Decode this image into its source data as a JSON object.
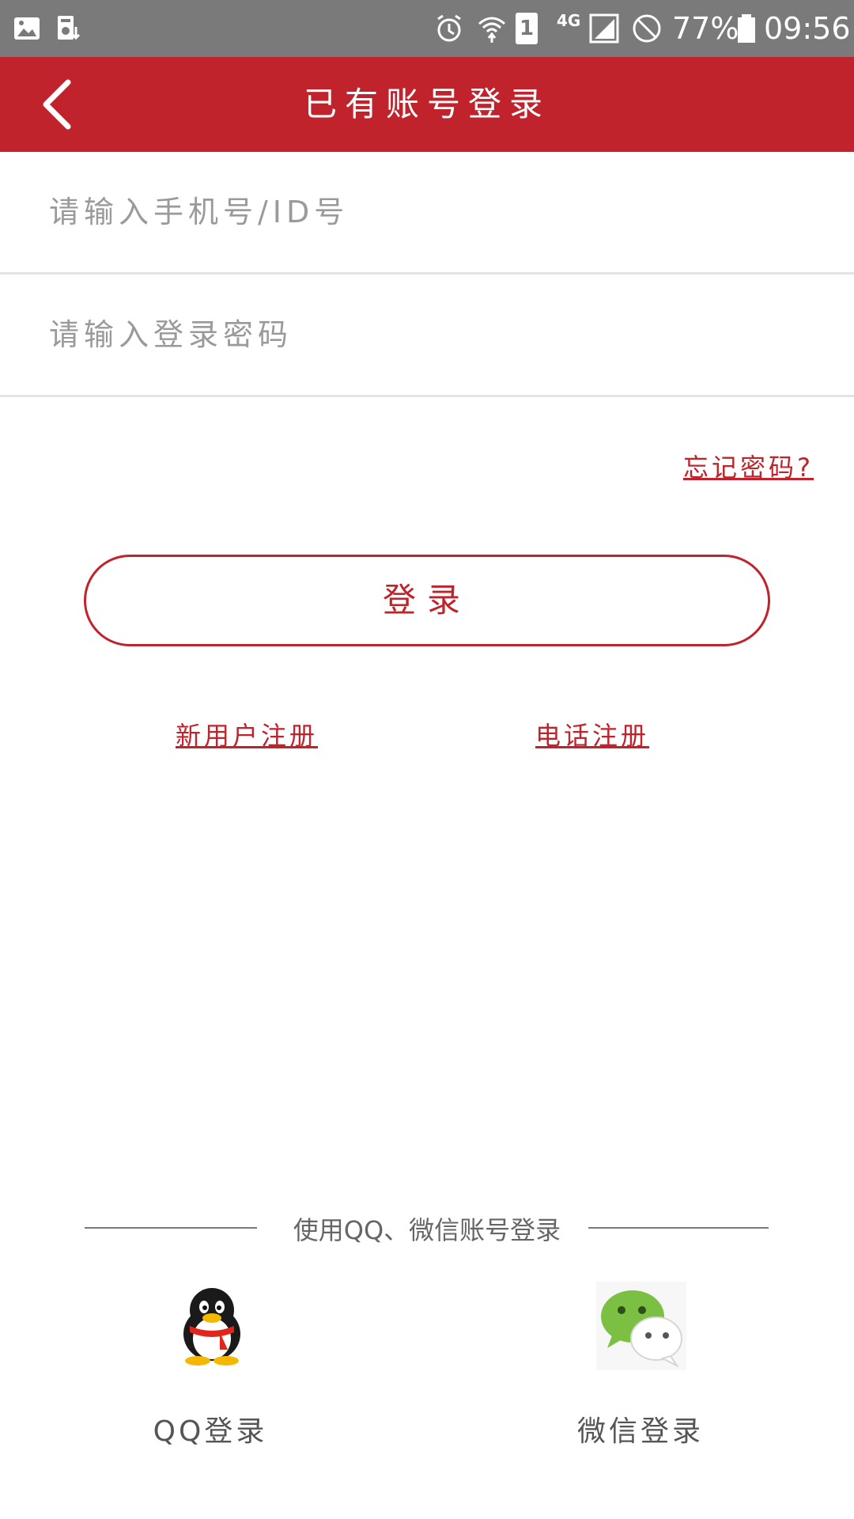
{
  "status_bar": {
    "network_label": "4G",
    "sim_label": "1",
    "battery": "77%",
    "time": "09:56"
  },
  "header": {
    "title": "已有账号登录"
  },
  "form": {
    "account_placeholder": "请输入手机号/ID号",
    "password_placeholder": "请输入登录密码",
    "forgot_password": "忘记密码?",
    "login_label": "登录"
  },
  "register_links": {
    "new_user": "新用户注册",
    "phone": "电话注册"
  },
  "social": {
    "divider_text": "使用QQ、微信账号登录",
    "qq_label": "QQ登录",
    "wechat_label": "微信登录"
  },
  "colors": {
    "brand_red": "#c0232b",
    "status_bar_gray": "#7a7a7a",
    "wechat_green": "#7bc043"
  }
}
